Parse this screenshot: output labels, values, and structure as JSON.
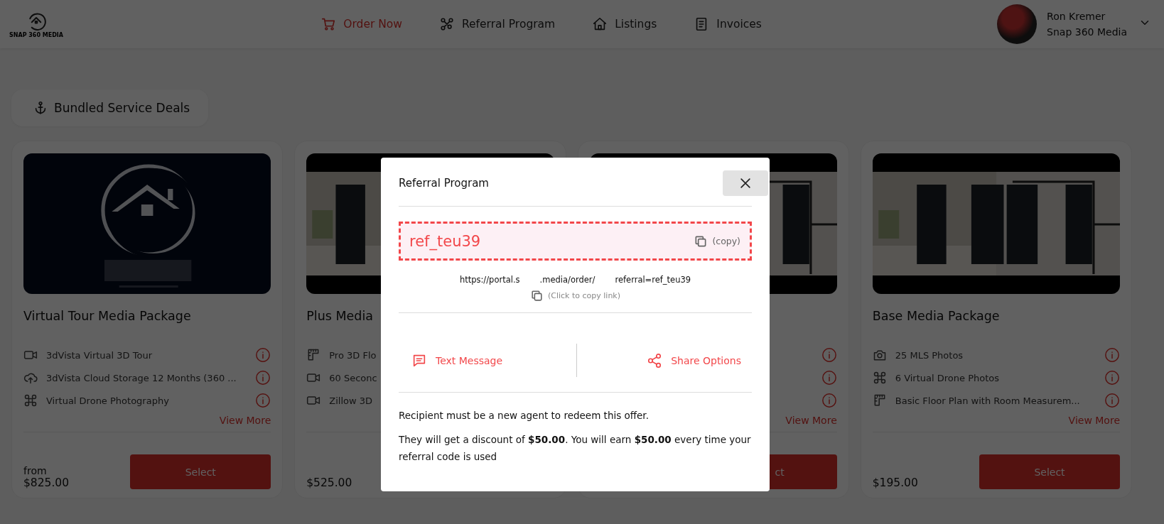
{
  "header": {
    "logo_text": "SNAP 360 MEDIA",
    "nav": [
      {
        "label": "Order Now",
        "selected": true
      },
      {
        "label": "Referral Program",
        "selected": false
      },
      {
        "label": "Listings",
        "selected": false
      },
      {
        "label": "Invoices",
        "selected": false
      }
    ],
    "user": {
      "name": "Ron Kremer",
      "company": "Snap 360 Media"
    }
  },
  "section": {
    "title": "Bundled Service Deals"
  },
  "cards": [
    {
      "kind": "full",
      "title": "Virtual Tour Media Package",
      "price_prefix": "from",
      "price": "$825.00",
      "features": [
        {
          "kind": "video",
          "text": "3dVista Virtual 3D Tour",
          "info": true
        },
        {
          "kind": "cloud",
          "text": "3dVista Cloud Storage 12 Months (360 ...",
          "info": true
        },
        {
          "kind": "drone",
          "text": "Virtual Drone Photography",
          "info": true
        }
      ],
      "view_more": "View More",
      "select": "Select"
    },
    {
      "kind": "covered",
      "title": "Plus Media",
      "price": "$525.00",
      "features": [
        {
          "kind": "floorplan",
          "text": "Pro 3D Flo",
          "info": false
        },
        {
          "kind": "video",
          "text": "60 Seconc",
          "info": false
        },
        {
          "kind": "video",
          "text": "Zillow 3D",
          "info": false
        }
      ]
    },
    {
      "kind": "covered",
      "features": [
        {
          "info": true
        },
        {
          "info": true
        },
        {
          "info": true
        }
      ],
      "view_more": "View More",
      "select": "ct"
    },
    {
      "kind": "full",
      "title": "Base Media Package",
      "price": "$195.00",
      "features": [
        {
          "kind": "camera",
          "text": "25 MLS Photos",
          "info": true
        },
        {
          "kind": "drone",
          "text": "6 Virtual Drone Photos",
          "info": true
        },
        {
          "kind": "floorplan",
          "text": "Basic Floor Plan with Room Measurem...",
          "info": true
        }
      ],
      "view_more": "View More",
      "select": "Select"
    }
  ],
  "modal": {
    "title": "Referral Program",
    "code": "ref_teu39",
    "copy_label": "(copy)",
    "link_parts": [
      "https://portal.s",
      ".media/order/",
      "referral=ref_teu39"
    ],
    "copy_link_label": "(Click to copy link)",
    "actions": [
      {
        "label": "Text Message"
      },
      {
        "label": "Share Options"
      }
    ],
    "notes": [
      "Recipient must be a new agent to redeem this offer.",
      "They will get a discount of **$50.00**. You will earn **$50.00** every time your referral code is used"
    ]
  }
}
